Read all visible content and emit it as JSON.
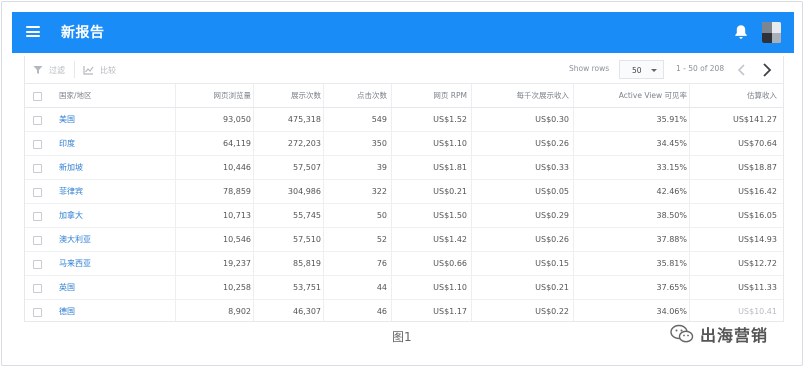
{
  "app": {
    "title": "新报告"
  },
  "toolbar": {
    "filter_label": "过滤",
    "compare_label": "比较",
    "show_rows_label": "Show rows",
    "rows_value": "50",
    "range_text": "1 - 50 of 208"
  },
  "table": {
    "columns": [
      "国家/地区",
      "网页浏览量",
      "展示次数",
      "点击次数",
      "网页 RPM",
      "每千次展示收入",
      "Active View 可见率",
      "估算收入"
    ],
    "rows": [
      [
        "美国",
        "93,050",
        "475,318",
        "549",
        "US$1.52",
        "US$0.30",
        "35.91%",
        "US$141.27"
      ],
      [
        "印度",
        "64,119",
        "272,203",
        "350",
        "US$1.10",
        "US$0.26",
        "34.45%",
        "US$70.64"
      ],
      [
        "新加坡",
        "10,446",
        "57,507",
        "39",
        "US$1.81",
        "US$0.33",
        "33.15%",
        "US$18.87"
      ],
      [
        "菲律宾",
        "78,859",
        "304,986",
        "322",
        "US$0.21",
        "US$0.05",
        "42.46%",
        "US$16.42"
      ],
      [
        "加拿大",
        "10,713",
        "55,745",
        "50",
        "US$1.50",
        "US$0.29",
        "38.50%",
        "US$16.05"
      ],
      [
        "澳大利亚",
        "10,546",
        "57,510",
        "52",
        "US$1.42",
        "US$0.26",
        "37.88%",
        "US$14.93"
      ],
      [
        "马来西亚",
        "19,237",
        "85,819",
        "76",
        "US$0.66",
        "US$0.15",
        "35.81%",
        "US$12.72"
      ],
      [
        "英国",
        "10,258",
        "53,751",
        "44",
        "US$1.10",
        "US$0.21",
        "37.65%",
        "US$11.33"
      ],
      [
        "德国",
        "8,902",
        "46,307",
        "46",
        "US$1.17",
        "US$0.22",
        "34.06%",
        "US$10.41"
      ]
    ]
  },
  "caption": "图1",
  "watermark": "出海营销",
  "colors": {
    "appbar": "#1a8cf7",
    "link": "#2d7fd3"
  }
}
